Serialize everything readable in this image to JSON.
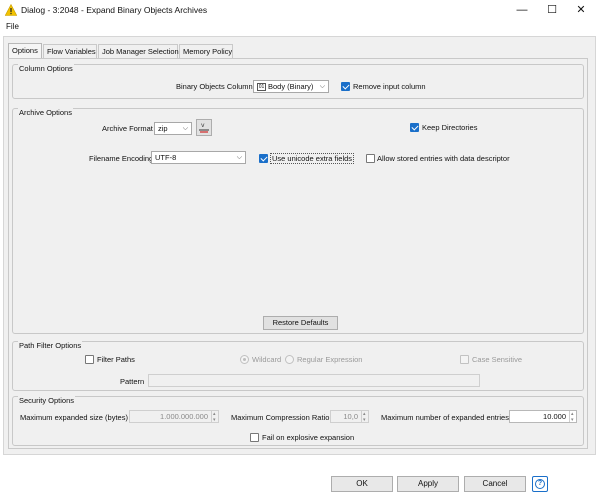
{
  "window": {
    "title": "Dialog - 3:2048 - Expand Binary Objects Archives",
    "minimize": "—",
    "maximize": "☐",
    "close": "✕"
  },
  "menu": {
    "file": "File"
  },
  "tabs": [
    {
      "label": "Options",
      "active": true
    },
    {
      "label": "Flow Variables"
    },
    {
      "label": "Job Manager Selection"
    },
    {
      "label": "Memory Policy"
    }
  ],
  "column_options": {
    "title": "Column Options",
    "binary_column_label": "Binary Objects Column",
    "binary_column_value": "Body (Binary)",
    "remove_input_label": "Remove input column",
    "remove_input_checked": true
  },
  "archive_options": {
    "title": "Archive Options",
    "format_label": "Archive Format",
    "format_value": "zip",
    "keep_dirs_label": "Keep Directories",
    "keep_dirs_checked": true,
    "encoding_label": "Filename Encoding",
    "encoding_value": "UTF-8",
    "unicode_label": "Use unicode extra fields",
    "unicode_checked": true,
    "stored_entries_label": "Allow stored entries with data descriptor",
    "stored_entries_checked": false,
    "restore_label": "Restore Defaults"
  },
  "path_filter": {
    "title": "Path Filter Options",
    "filter_label": "Filter Paths",
    "wildcard_label": "Wildcard",
    "regex_label": "Regular Expression",
    "case_label": "Case Sensitive",
    "pattern_label": "Pattern",
    "pattern_value": ""
  },
  "security": {
    "title": "Security Options",
    "max_size_label": "Maximum expanded size (bytes)",
    "max_size_value": "1.000.000.000",
    "ratio_label": "Maximum Compression Ratio",
    "ratio_value": "10,0",
    "entries_label": "Maximum number of expanded entries",
    "entries_value": "10.000",
    "explosive_label": "Fail on explosive expansion"
  },
  "footer": {
    "ok": "OK",
    "apply": "Apply",
    "cancel": "Cancel",
    "help": "?"
  },
  "colors": {
    "accent": "#1a6fc9",
    "warning_icon": "#f2c200"
  }
}
